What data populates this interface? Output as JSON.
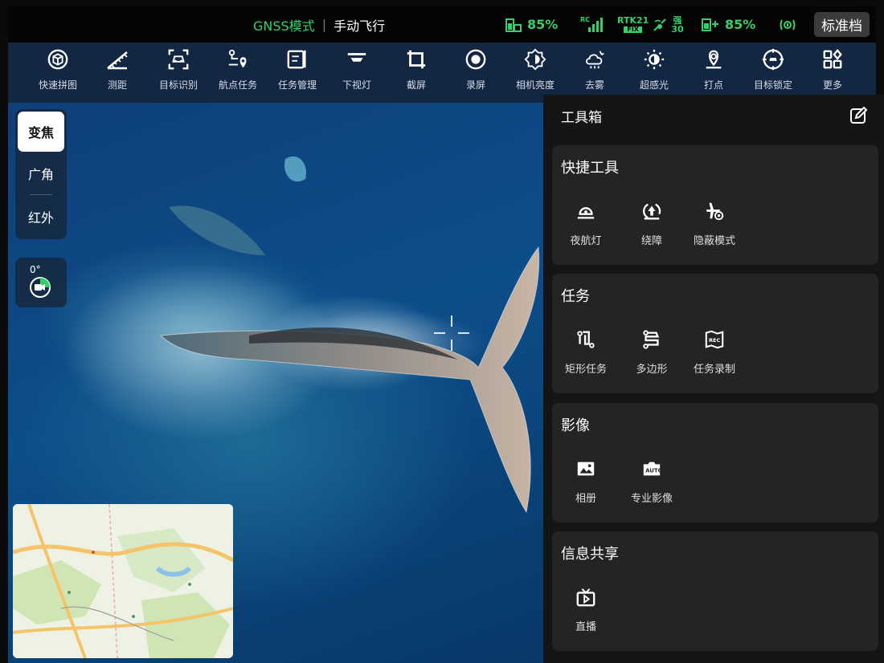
{
  "status": {
    "flight_mode": "GNSS模式",
    "control_mode": "手动飞行",
    "controller_battery": "85%",
    "rc_signal_label": "RC",
    "rtk_label": "RTK",
    "rtk_count": "21",
    "rtk_fix": "FIX",
    "satellite_strength": "强",
    "satellite_count": "30",
    "drone_battery": "85%",
    "profile_button": "标准档"
  },
  "toolbar": {
    "items": [
      {
        "label": "快速拼图",
        "icon": "cube-icon"
      },
      {
        "label": "测距",
        "icon": "ruler-icon"
      },
      {
        "label": "目标识别",
        "icon": "car-detect-icon"
      },
      {
        "label": "航点任务",
        "icon": "waypoint-icon"
      },
      {
        "label": "任务管理",
        "icon": "task-manage-icon"
      },
      {
        "label": "下视灯",
        "icon": "down-light-icon"
      },
      {
        "label": "截屏",
        "icon": "screenshot-icon"
      },
      {
        "label": "录屏",
        "icon": "record-icon"
      },
      {
        "label": "相机亮度",
        "icon": "brightness-icon"
      },
      {
        "label": "去雾",
        "icon": "defog-icon"
      },
      {
        "label": "超感光",
        "icon": "super-light-icon"
      },
      {
        "label": "打点",
        "icon": "pin-icon"
      },
      {
        "label": "目标锁定",
        "icon": "target-lock-icon"
      },
      {
        "label": "更多",
        "icon": "more-grid-icon"
      }
    ]
  },
  "lens": {
    "zoom": "变焦",
    "wide": "广角",
    "infrared": "红外",
    "active": "zoom"
  },
  "gimbal": {
    "angle": "0°"
  },
  "toolbox": {
    "title": "工具箱",
    "sections": [
      {
        "title": "快捷工具",
        "items": [
          {
            "label": "夜航灯",
            "icon": "night-light-icon"
          },
          {
            "label": "绕障",
            "icon": "obstacle-avoid-icon"
          },
          {
            "label": "隐蔽模式",
            "icon": "stealth-mode-icon"
          }
        ]
      },
      {
        "title": "任务",
        "items": [
          {
            "label": "矩形任务",
            "icon": "rectangle-task-icon"
          },
          {
            "label": "多边形",
            "icon": "polygon-task-icon"
          },
          {
            "label": "任务录制",
            "icon": "task-record-icon"
          }
        ]
      },
      {
        "title": "影像",
        "items": [
          {
            "label": "相册",
            "icon": "album-icon"
          },
          {
            "label": "专业影像",
            "icon": "pro-camera-auto-icon"
          }
        ]
      },
      {
        "title": "信息共享",
        "items": [
          {
            "label": "直播",
            "icon": "live-tv-icon"
          }
        ]
      }
    ]
  },
  "colors": {
    "accent_green": "#35d06a",
    "panel_bg": "#151515",
    "card_bg": "#242424"
  }
}
